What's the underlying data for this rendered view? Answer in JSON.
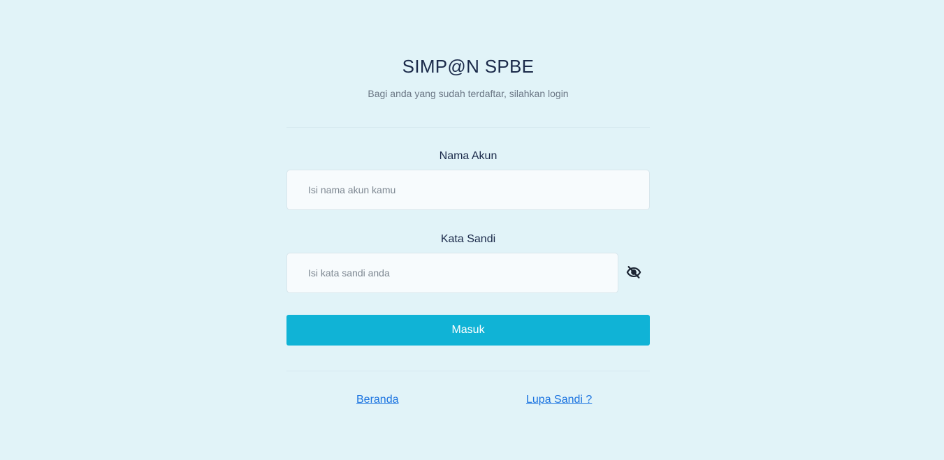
{
  "header": {
    "title": "SIMP@N SPBE",
    "subtitle": "Bagi anda yang sudah terdaftar, silahkan login"
  },
  "form": {
    "username": {
      "label": "Nama Akun",
      "placeholder": "Isi nama akun kamu",
      "value": ""
    },
    "password": {
      "label": "Kata Sandi",
      "placeholder": "Isi kata sandi anda",
      "value": "",
      "toggle_icon": "eye-slash-icon"
    },
    "submit_label": "Masuk"
  },
  "footer": {
    "home_link": "Beranda",
    "forgot_link": "Lupa Sandi ?"
  },
  "colors": {
    "background": "#e1f3f8",
    "accent": "#10b3d6",
    "link": "#1a73e0",
    "text": "#1b2a4a"
  }
}
